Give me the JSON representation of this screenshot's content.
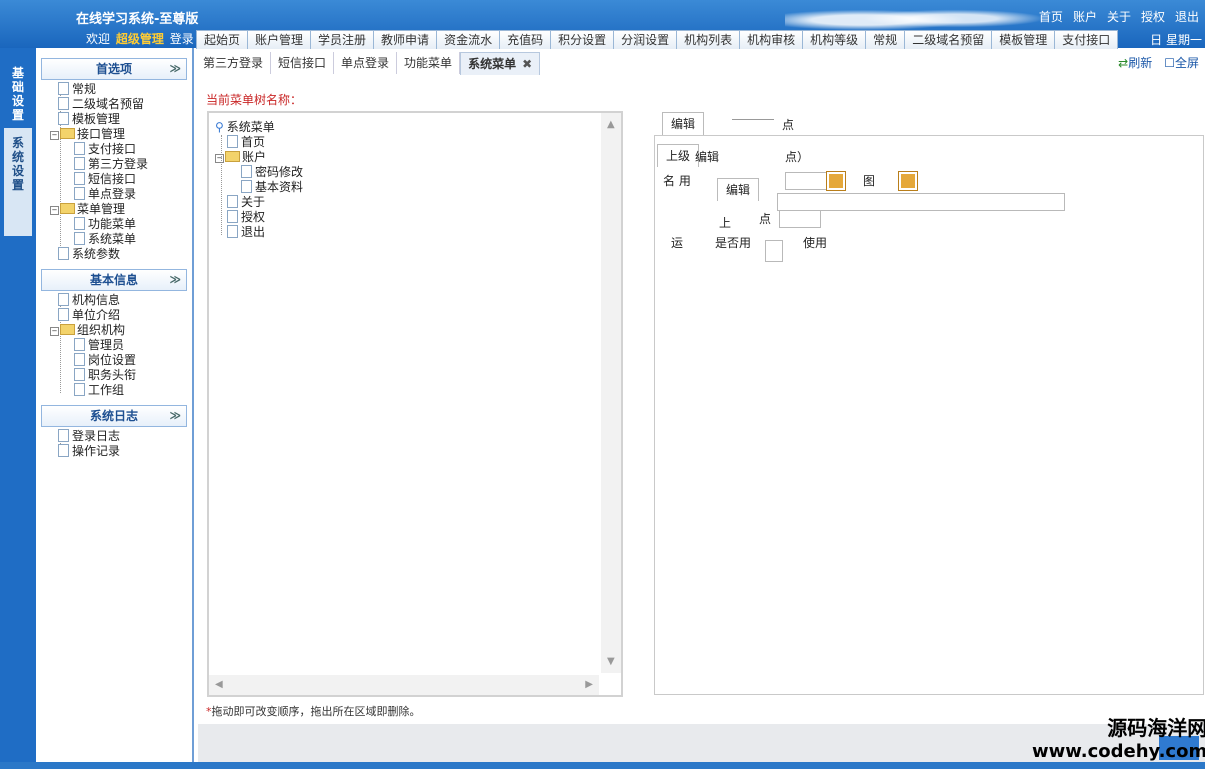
{
  "header": {
    "title": "在线学习系统-至尊版",
    "welcome_prefix": "欢迎",
    "role": "超级管理",
    "login": "登录",
    "links": [
      "首页",
      "账户",
      "关于",
      "授权",
      "退出"
    ],
    "date_fragment": "日 星期一"
  },
  "topnav": [
    "起始页",
    "账户管理",
    "学员注册",
    "教师申请",
    "资金流水",
    "充值码",
    "积分设置",
    "分润设置",
    "机构列表",
    "机构审核",
    "机构等级",
    "常规",
    "二级域名预留",
    "模板管理",
    "支付接口"
  ],
  "vtabs": {
    "inactive": "基础设置",
    "active": "系统设置"
  },
  "leftnav": {
    "section1": "首选项",
    "section2": "基本信息",
    "section3": "系统日志",
    "s1": [
      "常规",
      "二级域名预留",
      "模板管理",
      "接口管理",
      "支付接口",
      "第三方登录",
      "短信接口",
      "单点登录",
      "菜单管理",
      "功能菜单",
      "系统菜单",
      "系统参数"
    ],
    "s2": [
      "机构信息",
      "单位介绍",
      "组织机构",
      "管理员",
      "岗位设置",
      "职务头衔",
      "工作组"
    ],
    "s3": [
      "登录日志",
      "操作记录"
    ]
  },
  "subtabs": [
    "第三方登录",
    "短信接口",
    "单点登录",
    "功能菜单",
    "系统菜单"
  ],
  "tools": {
    "refresh": "刷新",
    "fullscreen": "全屏"
  },
  "tree_label": "当前菜单树名称：",
  "menu_tree": [
    "系统菜单",
    "首页",
    "账户",
    "密码修改",
    "基本资料",
    "关于",
    "授权",
    "退出"
  ],
  "edit": {
    "tab_edit": "编辑",
    "tab_point": "点",
    "parent_label": "上级",
    "parent_suffix": "点）",
    "name_frag": "名  用",
    "icon_label": "图",
    "edit_sub": "编辑",
    "up_frag": "上",
    "point_frag": "点",
    "enabled_prefix": "运",
    "enabled_label": "是否用",
    "use_label": "使用"
  },
  "hint": {
    "star": "*",
    "text": "拖动即可改变顺序，拖出所在区域即删除。"
  },
  "watermark": {
    "line1": "源码海洋网",
    "line2": "www.codehy.com"
  }
}
